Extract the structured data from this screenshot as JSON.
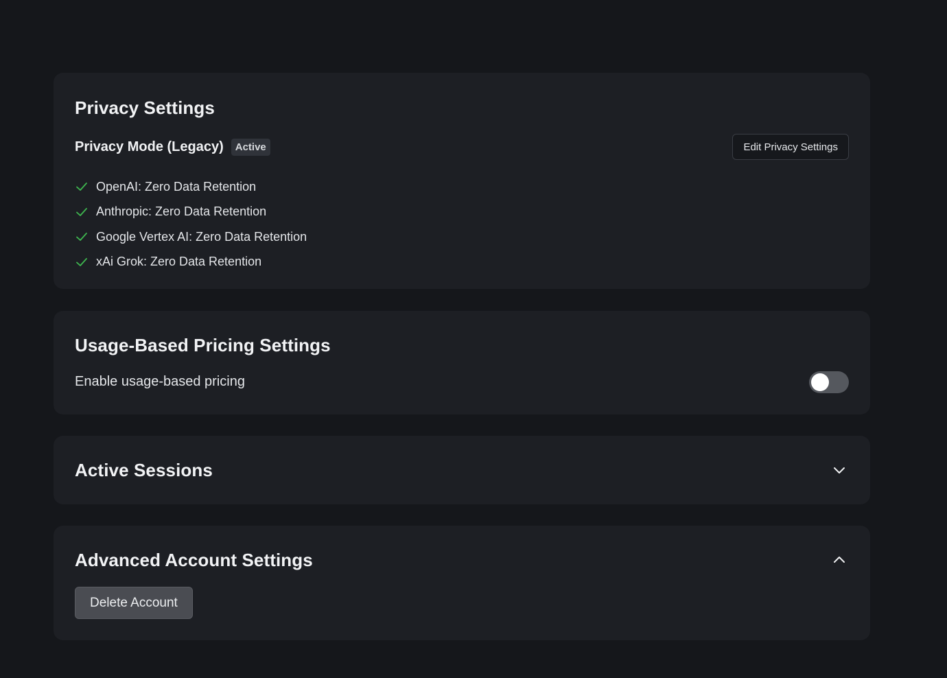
{
  "privacy": {
    "title": "Privacy Settings",
    "mode_label": "Privacy Mode (Legacy)",
    "status_badge": "Active",
    "edit_button": "Edit Privacy Settings",
    "check_color": "#3fb950",
    "providers": [
      {
        "label": "OpenAI: Zero Data Retention",
        "icon": "check-icon"
      },
      {
        "label": "Anthropic: Zero Data Retention",
        "icon": "check-icon"
      },
      {
        "label": "Google Vertex AI: Zero Data Retention",
        "icon": "check-icon"
      },
      {
        "label": "xAi Grok: Zero Data Retention",
        "icon": "check-icon"
      }
    ]
  },
  "usage": {
    "title": "Usage-Based Pricing Settings",
    "toggle_label": "Enable usage-based pricing",
    "toggle_enabled": false
  },
  "sessions": {
    "title": "Active Sessions",
    "expanded": false,
    "icon": "chevron-down-icon"
  },
  "advanced": {
    "title": "Advanced Account Settings",
    "expanded": true,
    "icon": "chevron-up-icon",
    "delete_button": "Delete Account"
  }
}
